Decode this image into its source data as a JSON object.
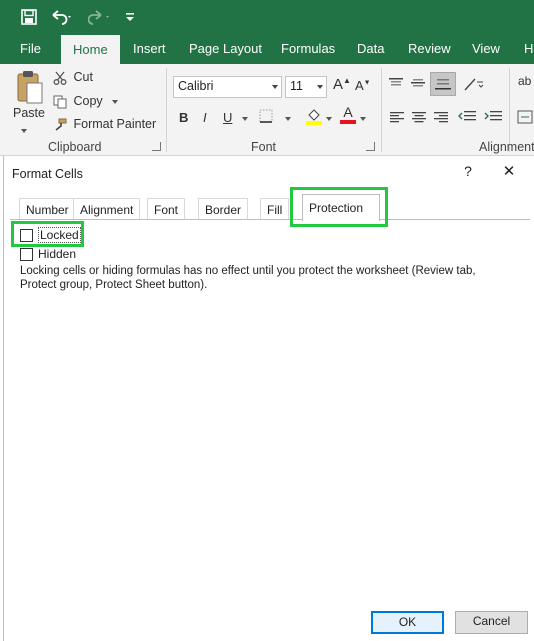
{
  "quick_access": {
    "save_icon": "save-icon",
    "undo_icon": "undo-icon",
    "redo_icon": "redo-icon",
    "more_icon": "customize-icon"
  },
  "ribbon_tabs": [
    "File",
    "Home",
    "Insert",
    "Page Layout",
    "Formulas",
    "Data",
    "Review",
    "View",
    "H"
  ],
  "active_tab": "Home",
  "clipboard": {
    "paste_label": "Paste",
    "cut_label": "Cut",
    "copy_label": "Copy",
    "format_painter_label": "Format Painter",
    "group_label": "Clipboard"
  },
  "font_group": {
    "font_name": "Calibri",
    "font_size": "11",
    "bold": "B",
    "italic": "I",
    "underline": "U",
    "grow_font": "A",
    "shrink_font": "A",
    "font_color_letter": "A",
    "group_label": "Font"
  },
  "alignment_group": {
    "group_label": "Alignment",
    "wrap_label": "ab"
  },
  "colors": {
    "excel_green": "#217346",
    "highlight_green": "#22c840",
    "fill_yellow": "#ffff00",
    "font_red": "#e81123"
  },
  "dialog": {
    "title": "Format Cells",
    "help": "?",
    "close": "✕",
    "tabs": [
      "Number",
      "Alignment",
      "Font",
      "Border",
      "Fill",
      "Protection"
    ],
    "active_tab": "Protection",
    "locked_label": "Locked",
    "hidden_label": "Hidden",
    "locked_checked": false,
    "hidden_checked": false,
    "info_line1": "Locking cells or hiding formulas has no effect until you protect the worksheet (Review tab,",
    "info_line2": "Protect group, Protect Sheet button).",
    "ok_label": "OK",
    "cancel_label": "Cancel"
  }
}
